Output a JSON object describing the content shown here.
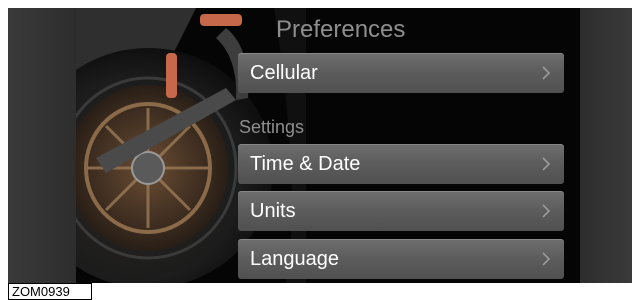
{
  "screen": {
    "title": "Preferences",
    "items_top": [
      {
        "label": "Cellular",
        "icon": "chevron-right-icon"
      }
    ],
    "section_label": "Settings",
    "items_settings": [
      {
        "label": "Time & Date",
        "icon": "chevron-right-icon"
      },
      {
        "label": "Units",
        "icon": "chevron-right-icon"
      },
      {
        "label": "Language",
        "icon": "chevron-right-icon"
      }
    ]
  },
  "caption": {
    "id": "ZOM0939"
  },
  "colors": {
    "row_bg": "#5e5e5e",
    "accent_fender": "#c8684a",
    "text_primary": "#ffffff",
    "text_dim": "#8e8e8e"
  }
}
